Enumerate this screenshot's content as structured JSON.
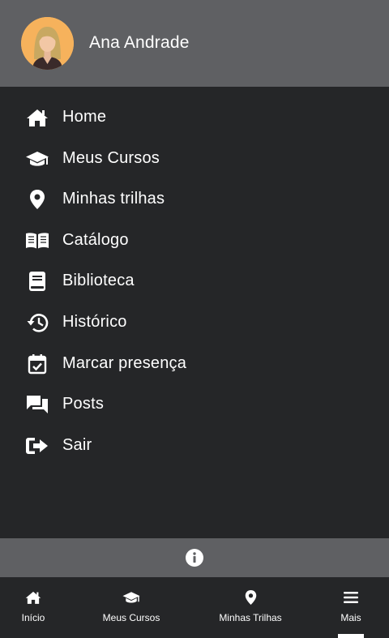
{
  "user": {
    "name": "Ana Andrade"
  },
  "menu": {
    "items": [
      {
        "label": "Home",
        "icon": "home-icon"
      },
      {
        "label": "Meus Cursos",
        "icon": "graduation-cap-icon"
      },
      {
        "label": "Minhas trilhas",
        "icon": "map-pin-icon"
      },
      {
        "label": "Catálogo",
        "icon": "open-book-icon"
      },
      {
        "label": "Biblioteca",
        "icon": "book-icon"
      },
      {
        "label": "Histórico",
        "icon": "history-icon"
      },
      {
        "label": "Marcar presença",
        "icon": "calendar-check-icon"
      },
      {
        "label": "Posts",
        "icon": "chat-bubbles-icon"
      },
      {
        "label": "Sair",
        "icon": "sign-out-icon"
      }
    ]
  },
  "info_bar": {
    "icon": "info-icon"
  },
  "bottom_nav": {
    "items": [
      {
        "label": "Início",
        "icon": "home-icon"
      },
      {
        "label": "Meus Cursos",
        "icon": "graduation-cap-icon"
      },
      {
        "label": "Minhas Trilhas",
        "icon": "map-pin-icon"
      },
      {
        "label": "Mais",
        "icon": "menu-icon",
        "active": true
      }
    ]
  },
  "colors": {
    "header_bg": "#5f6063",
    "menu_bg": "#252628",
    "text": "#ffffff",
    "avatar_bg": "#f6b25c"
  }
}
